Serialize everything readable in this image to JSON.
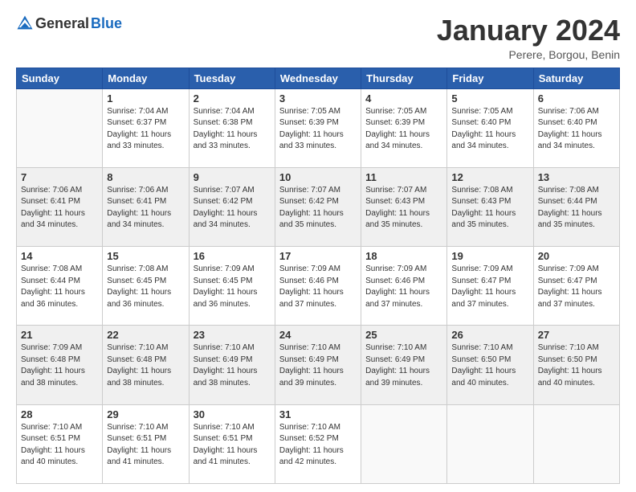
{
  "header": {
    "logo_general": "General",
    "logo_blue": "Blue",
    "title": "January 2024",
    "subtitle": "Perere, Borgou, Benin"
  },
  "days_of_week": [
    "Sunday",
    "Monday",
    "Tuesday",
    "Wednesday",
    "Thursday",
    "Friday",
    "Saturday"
  ],
  "weeks": [
    [
      {
        "day": "",
        "empty": true
      },
      {
        "day": "1",
        "sunrise": "7:04 AM",
        "sunset": "6:37 PM",
        "daylight": "11 hours and 33 minutes."
      },
      {
        "day": "2",
        "sunrise": "7:04 AM",
        "sunset": "6:38 PM",
        "daylight": "11 hours and 33 minutes."
      },
      {
        "day": "3",
        "sunrise": "7:05 AM",
        "sunset": "6:39 PM",
        "daylight": "11 hours and 33 minutes."
      },
      {
        "day": "4",
        "sunrise": "7:05 AM",
        "sunset": "6:39 PM",
        "daylight": "11 hours and 34 minutes."
      },
      {
        "day": "5",
        "sunrise": "7:05 AM",
        "sunset": "6:40 PM",
        "daylight": "11 hours and 34 minutes."
      },
      {
        "day": "6",
        "sunrise": "7:06 AM",
        "sunset": "6:40 PM",
        "daylight": "11 hours and 34 minutes."
      }
    ],
    [
      {
        "day": "7",
        "sunrise": "7:06 AM",
        "sunset": "6:41 PM",
        "daylight": "11 hours and 34 minutes."
      },
      {
        "day": "8",
        "sunrise": "7:06 AM",
        "sunset": "6:41 PM",
        "daylight": "11 hours and 34 minutes."
      },
      {
        "day": "9",
        "sunrise": "7:07 AM",
        "sunset": "6:42 PM",
        "daylight": "11 hours and 34 minutes."
      },
      {
        "day": "10",
        "sunrise": "7:07 AM",
        "sunset": "6:42 PM",
        "daylight": "11 hours and 35 minutes."
      },
      {
        "day": "11",
        "sunrise": "7:07 AM",
        "sunset": "6:43 PM",
        "daylight": "11 hours and 35 minutes."
      },
      {
        "day": "12",
        "sunrise": "7:08 AM",
        "sunset": "6:43 PM",
        "daylight": "11 hours and 35 minutes."
      },
      {
        "day": "13",
        "sunrise": "7:08 AM",
        "sunset": "6:44 PM",
        "daylight": "11 hours and 35 minutes."
      }
    ],
    [
      {
        "day": "14",
        "sunrise": "7:08 AM",
        "sunset": "6:44 PM",
        "daylight": "11 hours and 36 minutes."
      },
      {
        "day": "15",
        "sunrise": "7:08 AM",
        "sunset": "6:45 PM",
        "daylight": "11 hours and 36 minutes."
      },
      {
        "day": "16",
        "sunrise": "7:09 AM",
        "sunset": "6:45 PM",
        "daylight": "11 hours and 36 minutes."
      },
      {
        "day": "17",
        "sunrise": "7:09 AM",
        "sunset": "6:46 PM",
        "daylight": "11 hours and 37 minutes."
      },
      {
        "day": "18",
        "sunrise": "7:09 AM",
        "sunset": "6:46 PM",
        "daylight": "11 hours and 37 minutes."
      },
      {
        "day": "19",
        "sunrise": "7:09 AM",
        "sunset": "6:47 PM",
        "daylight": "11 hours and 37 minutes."
      },
      {
        "day": "20",
        "sunrise": "7:09 AM",
        "sunset": "6:47 PM",
        "daylight": "11 hours and 37 minutes."
      }
    ],
    [
      {
        "day": "21",
        "sunrise": "7:09 AM",
        "sunset": "6:48 PM",
        "daylight": "11 hours and 38 minutes."
      },
      {
        "day": "22",
        "sunrise": "7:10 AM",
        "sunset": "6:48 PM",
        "daylight": "11 hours and 38 minutes."
      },
      {
        "day": "23",
        "sunrise": "7:10 AM",
        "sunset": "6:49 PM",
        "daylight": "11 hours and 38 minutes."
      },
      {
        "day": "24",
        "sunrise": "7:10 AM",
        "sunset": "6:49 PM",
        "daylight": "11 hours and 39 minutes."
      },
      {
        "day": "25",
        "sunrise": "7:10 AM",
        "sunset": "6:49 PM",
        "daylight": "11 hours and 39 minutes."
      },
      {
        "day": "26",
        "sunrise": "7:10 AM",
        "sunset": "6:50 PM",
        "daylight": "11 hours and 40 minutes."
      },
      {
        "day": "27",
        "sunrise": "7:10 AM",
        "sunset": "6:50 PM",
        "daylight": "11 hours and 40 minutes."
      }
    ],
    [
      {
        "day": "28",
        "sunrise": "7:10 AM",
        "sunset": "6:51 PM",
        "daylight": "11 hours and 40 minutes."
      },
      {
        "day": "29",
        "sunrise": "7:10 AM",
        "sunset": "6:51 PM",
        "daylight": "11 hours and 41 minutes."
      },
      {
        "day": "30",
        "sunrise": "7:10 AM",
        "sunset": "6:51 PM",
        "daylight": "11 hours and 41 minutes."
      },
      {
        "day": "31",
        "sunrise": "7:10 AM",
        "sunset": "6:52 PM",
        "daylight": "11 hours and 42 minutes."
      },
      {
        "day": "",
        "empty": true
      },
      {
        "day": "",
        "empty": true
      },
      {
        "day": "",
        "empty": true
      }
    ]
  ],
  "labels": {
    "sunrise_prefix": "Sunrise: ",
    "sunset_prefix": "Sunset: ",
    "daylight_prefix": "Daylight: "
  }
}
